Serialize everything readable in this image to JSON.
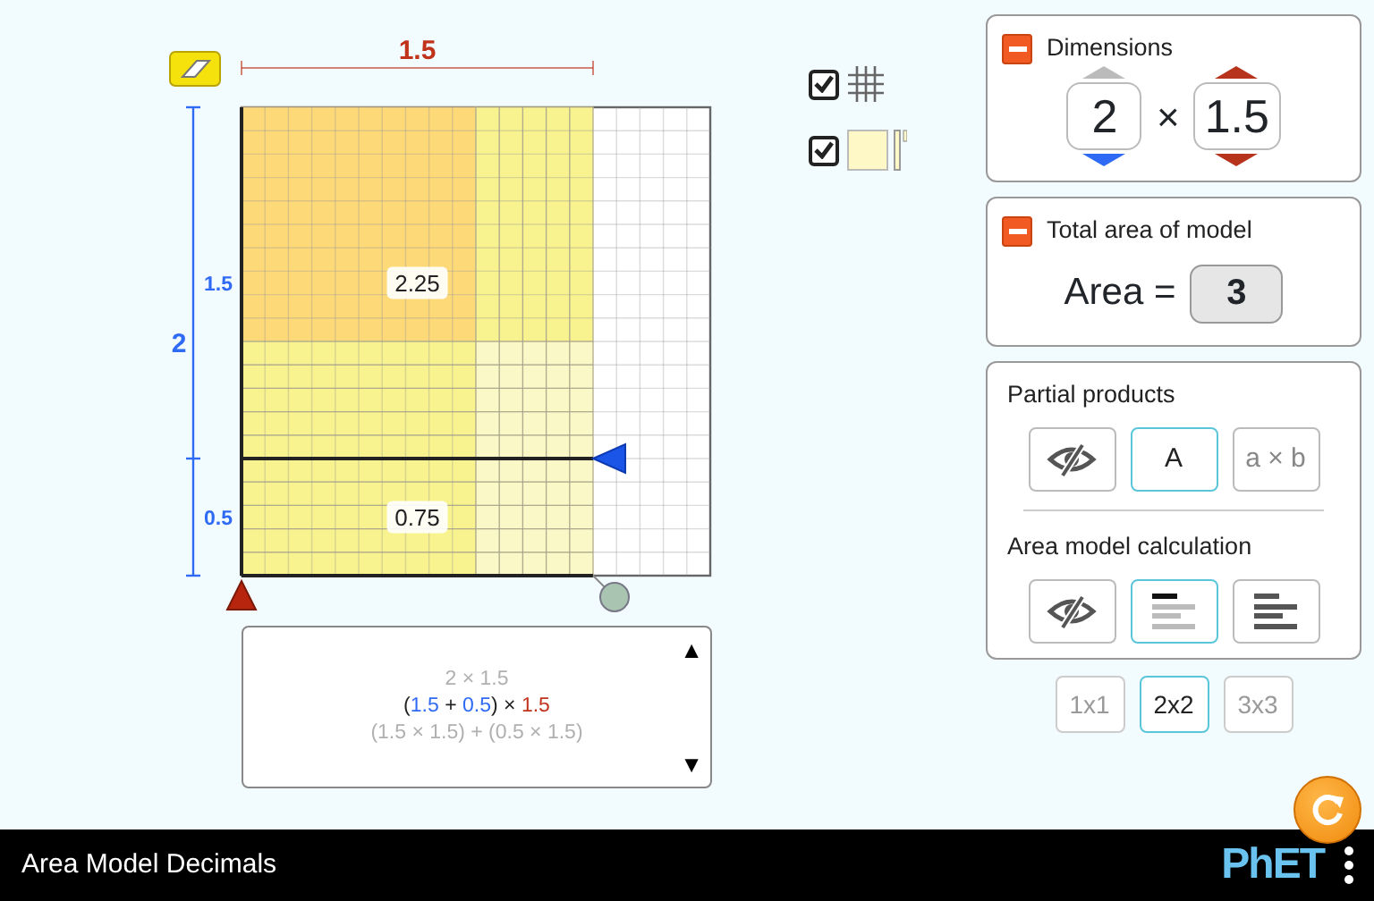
{
  "area_model": {
    "width": {
      "label": "1.5",
      "color": "#c0321a"
    },
    "height": {
      "label": "2",
      "color": "#2f6af5"
    },
    "height_partitions": [
      {
        "label": "1.5",
        "product": "2.25"
      },
      {
        "label": "0.5",
        "product": "0.75"
      }
    ]
  },
  "display_options": [
    {
      "kind": "grid",
      "checked": true
    },
    {
      "kind": "tiles",
      "checked": true
    }
  ],
  "calculation": {
    "scroll_up": "▲",
    "scroll_down": "▼",
    "lines": [
      {
        "segments": [
          {
            "text": "2 × 1.5",
            "color": "#b0b0b0"
          }
        ]
      },
      {
        "segments": [
          {
            "text": "(",
            "color": "#222222"
          },
          {
            "text": "1.5",
            "color": "#2f6af5"
          },
          {
            "text": " + ",
            "color": "#222222"
          },
          {
            "text": "0.5",
            "color": "#2f6af5"
          },
          {
            "text": ") × ",
            "color": "#222222"
          },
          {
            "text": "1.5",
            "color": "#c0321a"
          }
        ]
      },
      {
        "segments": [
          {
            "text": "(1.5 × 1.5) + (0.5 × 1.5)",
            "color": "#b0b0b0"
          }
        ]
      }
    ]
  },
  "dimensions_panel": {
    "title": "Dimensions",
    "expanded": true,
    "operator": "×",
    "factors": [
      {
        "value": "2",
        "color": "#2f6af5",
        "up_enabled": false,
        "down_enabled": true
      },
      {
        "value": "1.5",
        "color": "#b8331b",
        "up_enabled": true,
        "down_enabled": true
      }
    ]
  },
  "area_panel": {
    "title": "Total area of model",
    "expanded": true,
    "label": "Area =",
    "value": "3"
  },
  "options_panel": {
    "partial_products": {
      "title": "Partial products",
      "options": [
        {
          "kind": "hidden",
          "selected": false
        },
        {
          "kind": "text",
          "label": "A",
          "selected": true
        },
        {
          "kind": "text",
          "label": "a × b",
          "selected": false
        }
      ]
    },
    "calculation": {
      "title": "Area model calculation",
      "options": [
        {
          "kind": "hidden",
          "selected": false
        },
        {
          "kind": "line_by_line",
          "selected": true
        },
        {
          "kind": "all_lines",
          "selected": false
        }
      ]
    }
  },
  "grid_sizes": [
    {
      "label": "1x1",
      "selected": false
    },
    {
      "label": "2x2",
      "selected": true
    },
    {
      "label": "3x3",
      "selected": false
    }
  ],
  "title_bar": {
    "title": "Area Model Decimals",
    "logo": "PhET"
  }
}
